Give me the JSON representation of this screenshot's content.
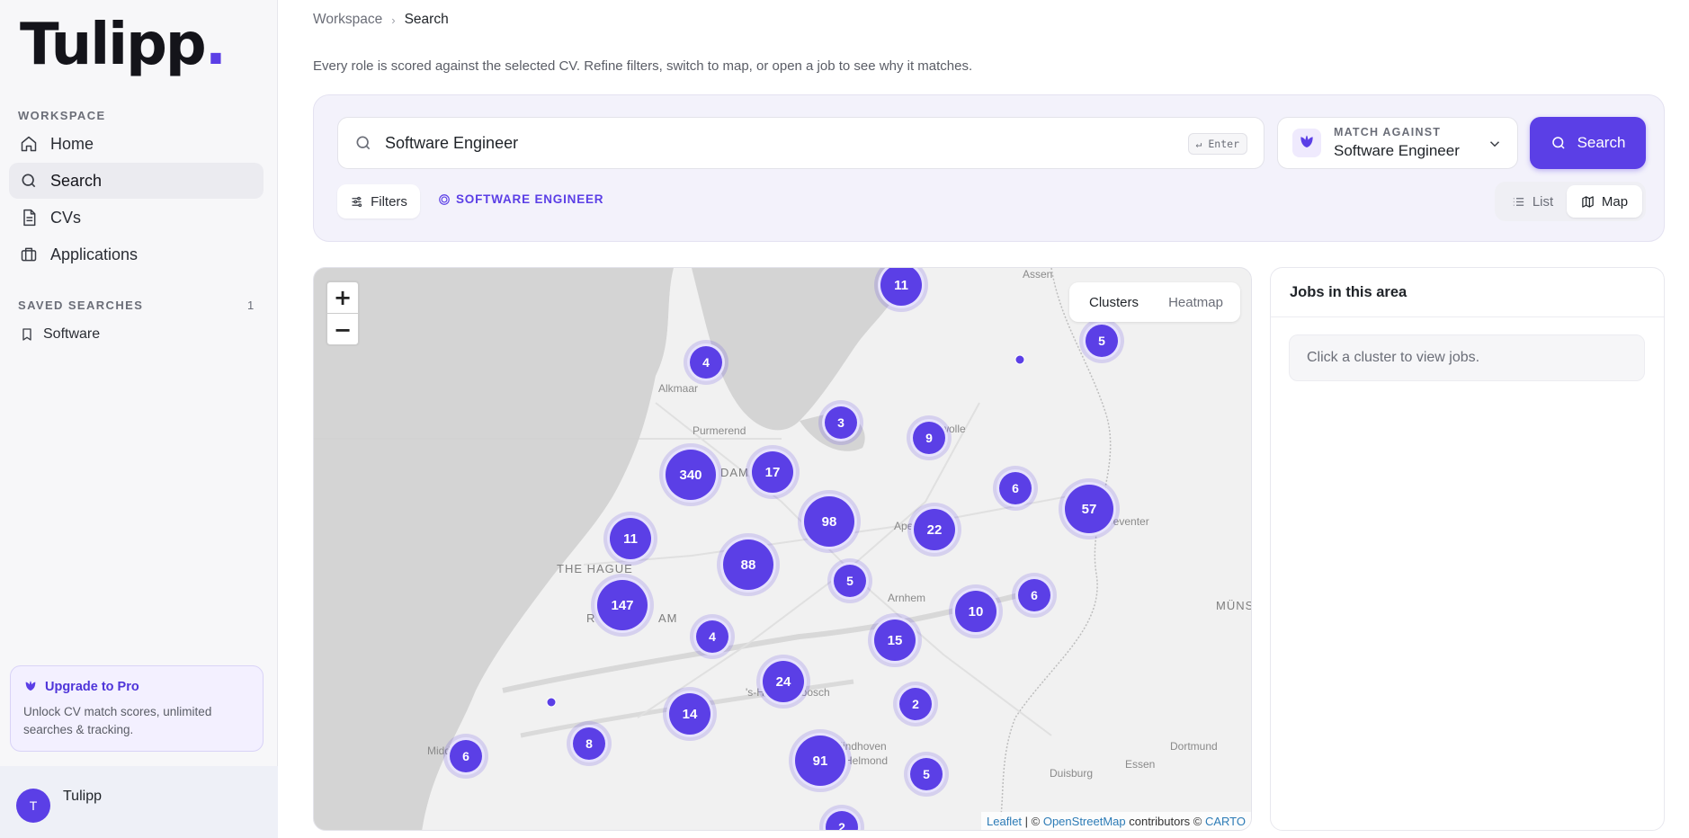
{
  "brand": {
    "name": "Tulipp",
    "logo_text": "Tulipp",
    "logo_dot": "."
  },
  "sidebar": {
    "workspace_label": "WORKSPACE",
    "items": [
      {
        "label": "Home",
        "icon": "home-icon"
      },
      {
        "label": "Search",
        "icon": "search-icon",
        "active": true
      },
      {
        "label": "CVs",
        "icon": "document-icon"
      },
      {
        "label": "Applications",
        "icon": "briefcase-icon"
      }
    ],
    "saved_label": "SAVED SEARCHES",
    "saved_count": "1",
    "saved_items": [
      {
        "label": "Software",
        "icon": "bookmark-icon"
      }
    ],
    "upgrade": {
      "title": "Upgrade to Pro",
      "text": "Unlock CV match scores, unlimited searches & tracking."
    },
    "user": {
      "initial": "T",
      "name": "Tulipp"
    }
  },
  "breadcrumb": {
    "parent": "Workspace",
    "current": "Search"
  },
  "description": "Every role is scored against the selected CV. Refine filters, switch to map, or open a job to see why it matches.",
  "search": {
    "value": "Software Engineer",
    "enter_hint": "↵ Enter",
    "match_label": "MATCH AGAINST",
    "match_value": "Software Engineer",
    "button": "Search",
    "filters": "Filters",
    "active_chip": "SOFTWARE ENGINEER"
  },
  "view_toggle": {
    "list": "List",
    "map": "Map",
    "selected": "Map"
  },
  "map": {
    "mode_clusters": "Clusters",
    "mode_heatmap": "Heatmap",
    "selected_mode": "Clusters",
    "zoom_in": "+",
    "zoom_out": "−",
    "clusters": [
      "11",
      "5",
      "4",
      "3",
      "9",
      "340",
      "17",
      "6",
      "57",
      "98",
      "22",
      "11",
      "88",
      "5",
      "147",
      "6",
      "10",
      "4",
      "15",
      "24",
      "2",
      "14",
      "8",
      "6",
      "91",
      "5",
      "2"
    ],
    "places": [
      "Assen",
      "Alkmaar",
      "Purmerend",
      "DAM",
      "THE HAGUE",
      "R",
      "AM",
      "Apel",
      "Arnhem",
      "MÜNS",
      "Zwolle",
      "Deventer",
      "'s-Hertogenbosch",
      "Eindhoven",
      "Helmond",
      "Dortmund",
      "Duisburg",
      "Essen",
      "Middelburg"
    ],
    "attribution": {
      "leaflet": "Leaflet",
      "sep": " | © ",
      "osm": "OpenStreetMap",
      "contrib": " contributors © ",
      "carto": "CARTO"
    }
  },
  "jobs_panel": {
    "title": "Jobs in this area",
    "empty": "Click a cluster to view jobs."
  },
  "colors": {
    "accent": "#5b3fe6",
    "sidebar_bg": "#f7f7f9",
    "panel_bg": "#f3f2fb"
  }
}
